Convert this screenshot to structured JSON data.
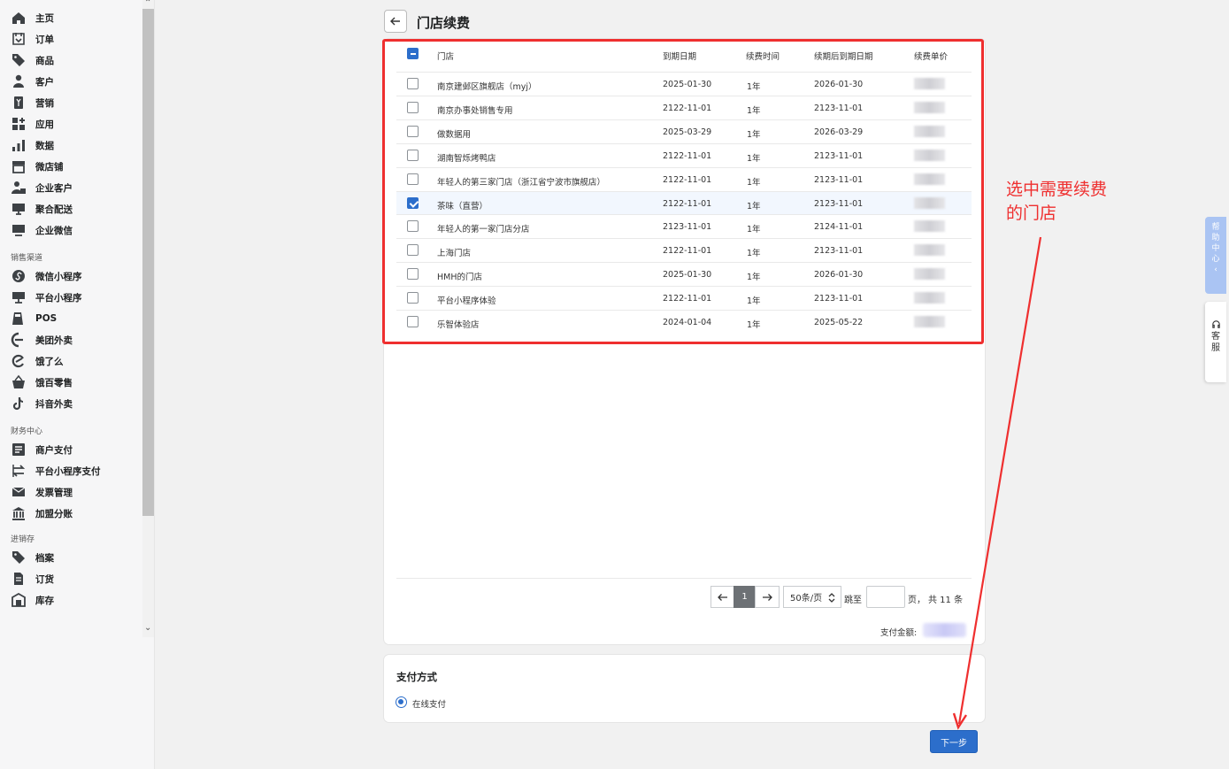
{
  "sidebar": {
    "items": [
      {
        "label": "主页",
        "icon": "home-icon"
      },
      {
        "label": "订单",
        "icon": "order-icon"
      },
      {
        "label": "商品",
        "icon": "tag-icon"
      },
      {
        "label": "客户",
        "icon": "person-icon"
      },
      {
        "label": "营销",
        "icon": "marketing-icon"
      },
      {
        "label": "应用",
        "icon": "apps-icon"
      },
      {
        "label": "数据",
        "icon": "bar-chart-icon"
      },
      {
        "label": "微店铺",
        "icon": "store-icon"
      },
      {
        "label": "企业客户",
        "icon": "business-customer-icon"
      },
      {
        "label": "聚合配送",
        "icon": "delivery-icon"
      },
      {
        "label": "企业微信",
        "icon": "wecom-icon"
      }
    ],
    "sections": [
      {
        "title": "销售渠道",
        "items": [
          {
            "label": "微信小程序",
            "icon": "wechat-miniapp-icon"
          },
          {
            "label": "平台小程序",
            "icon": "platform-miniapp-icon"
          },
          {
            "label": "POS",
            "icon": "pos-icon"
          },
          {
            "label": "美团外卖",
            "icon": "meituan-icon"
          },
          {
            "label": "饿了么",
            "icon": "eleme-icon"
          },
          {
            "label": "饿百零售",
            "icon": "retail-basket-icon"
          },
          {
            "label": "抖音外卖",
            "icon": "douyin-icon"
          }
        ]
      },
      {
        "title": "财务中心",
        "items": [
          {
            "label": "商户支付",
            "icon": "merchant-pay-icon"
          },
          {
            "label": "平台小程序支付",
            "icon": "transfer-icon"
          },
          {
            "label": "发票管理",
            "icon": "invoice-icon"
          },
          {
            "label": "加盟分账",
            "icon": "bank-icon"
          }
        ]
      },
      {
        "title": "进销存",
        "items": [
          {
            "label": "档案",
            "icon": "tag-icon"
          },
          {
            "label": "订货",
            "icon": "document-icon"
          },
          {
            "label": "库存",
            "icon": "warehouse-icon"
          }
        ]
      }
    ]
  },
  "page": {
    "title": "门店续费"
  },
  "table": {
    "headers": [
      "门店",
      "到期日期",
      "续费时间",
      "续期后到期日期",
      "续费单价"
    ],
    "rows": [
      {
        "store": "南京建邺区旗舰店（myj）",
        "expiry": "2025-01-30",
        "duration": "1年",
        "new_expiry": "2026-01-30",
        "selected": false
      },
      {
        "store": "南京办事处销售专用",
        "expiry": "2122-11-01",
        "duration": "1年",
        "new_expiry": "2123-11-01",
        "selected": false
      },
      {
        "store": "做数据用",
        "expiry": "2025-03-29",
        "duration": "1年",
        "new_expiry": "2026-03-29",
        "selected": false
      },
      {
        "store": "湖南智烁烤鸭店",
        "expiry": "2122-11-01",
        "duration": "1年",
        "new_expiry": "2123-11-01",
        "selected": false
      },
      {
        "store": "年轻人的第三家门店（浙江省宁波市旗舰店）",
        "expiry": "2122-11-01",
        "duration": "1年",
        "new_expiry": "2123-11-01",
        "selected": false
      },
      {
        "store": "茶味（直营）",
        "expiry": "2122-11-01",
        "duration": "1年",
        "new_expiry": "2123-11-01",
        "selected": true
      },
      {
        "store": "年轻人的第一家门店分店",
        "expiry": "2123-11-01",
        "duration": "1年",
        "new_expiry": "2124-11-01",
        "selected": false
      },
      {
        "store": "上海门店",
        "expiry": "2122-11-01",
        "duration": "1年",
        "new_expiry": "2123-11-01",
        "selected": false
      },
      {
        "store": "HMH的门店",
        "expiry": "2025-01-30",
        "duration": "1年",
        "new_expiry": "2026-01-30",
        "selected": false
      },
      {
        "store": "平台小程序体验",
        "expiry": "2122-11-01",
        "duration": "1年",
        "new_expiry": "2123-11-01",
        "selected": false
      },
      {
        "store": "乐智体验店",
        "expiry": "2024-01-04",
        "duration": "1年",
        "new_expiry": "2025-05-22",
        "selected": false
      }
    ]
  },
  "pagination": {
    "current_page": "1",
    "page_size": "50条/页",
    "jump_label": "跳至",
    "page_unit": "页，",
    "total": "共 11 条"
  },
  "payment": {
    "amount_label": "支付金额:",
    "method_title": "支付方式",
    "method_option": "在线支付"
  },
  "actions": {
    "next": "下一步"
  },
  "annotation": {
    "text": "选中需要续费的门店"
  },
  "floating": {
    "help": [
      "帮",
      "助",
      "中",
      "心"
    ],
    "service": [
      "客",
      "服"
    ]
  },
  "colors": {
    "primary": "#2c6ecb",
    "annotation": "#ef2f2f",
    "help_tab": "#aac4f3"
  }
}
